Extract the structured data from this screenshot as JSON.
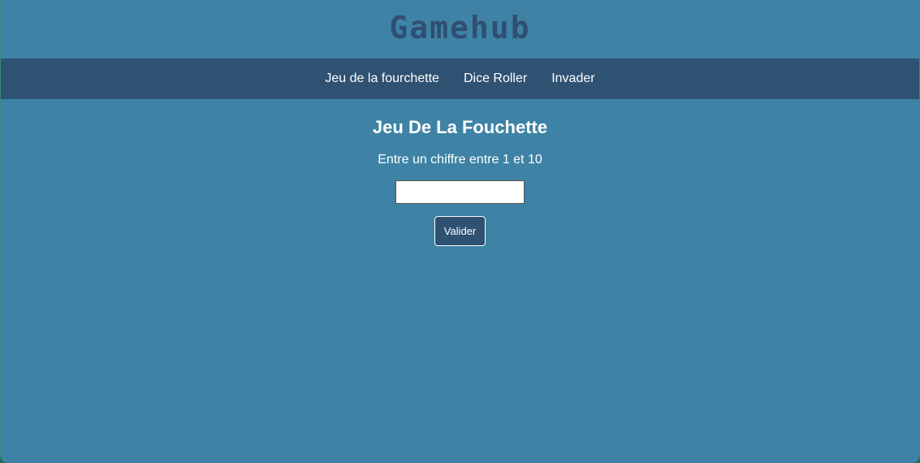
{
  "header": {
    "logo_text": "Gamehub"
  },
  "nav": {
    "items": [
      {
        "label": "Jeu de la fourchette"
      },
      {
        "label": "Dice Roller"
      },
      {
        "label": "Invader"
      }
    ]
  },
  "game": {
    "title": "Jeu De La Fouchette",
    "instruction": "Entre un chiffre entre 1 et 10",
    "input_value": "",
    "submit_label": "Valider"
  },
  "colors": {
    "background": "#3e83a5",
    "nav_background": "#2f5273",
    "logo": "#2f4f72",
    "text": "#ffffff"
  }
}
